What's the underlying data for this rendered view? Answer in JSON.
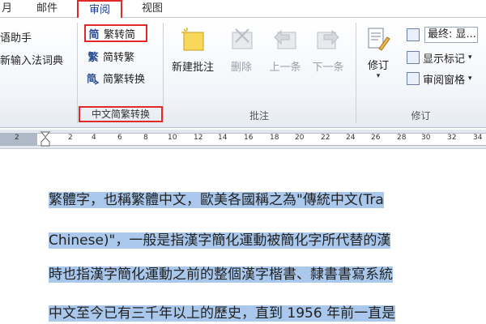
{
  "tabs": {
    "partial_left": "月",
    "mail": "邮件",
    "review": "审阅",
    "view": "视图"
  },
  "left_group": {
    "item1": "语助手",
    "item2": "新输入法词典"
  },
  "chinese_conversion": {
    "trad_to_simp": "繁转简",
    "simp_to_trad": "简转繁",
    "convert": "简繁转换",
    "group_label": "中文简繁转换",
    "icon_simp_glyph": "简",
    "icon_trad_glyph": "繁"
  },
  "comments": {
    "new_comment": "新建批注",
    "delete": "删除",
    "previous": "上一条",
    "next": "下一条",
    "group_label": "批注"
  },
  "tracking": {
    "track_changes": "修订",
    "display_for_review": "最终: 显...",
    "show_markup": "显示标记",
    "reviewing_pane": "审阅窗格",
    "group_label": "修订",
    "dropdown_arrow": "▾"
  },
  "ruler": {
    "ticks": [
      "2",
      "2",
      "4",
      "6",
      "8",
      "10",
      "12",
      "14",
      "16",
      "18",
      "20",
      "22",
      "24",
      "26",
      "28",
      "30",
      "32",
      "34"
    ]
  },
  "document": {
    "line1": "繁體字，也稱繁體中文，歐美各國稱之為\"傳統中文(Tra",
    "line2": "Chinese)\"，一般是指漢字簡化運動被簡化字所代替的漢",
    "line3": "時也指漢字簡化運動之前的整個漢字楷書、隸書書寫系統",
    "line4": "中文至今已有三千年以上的歷史，直到 1956 年前一直是"
  },
  "colors": {
    "highlight": "#e02a2a",
    "selection": "#a9c8ec"
  }
}
